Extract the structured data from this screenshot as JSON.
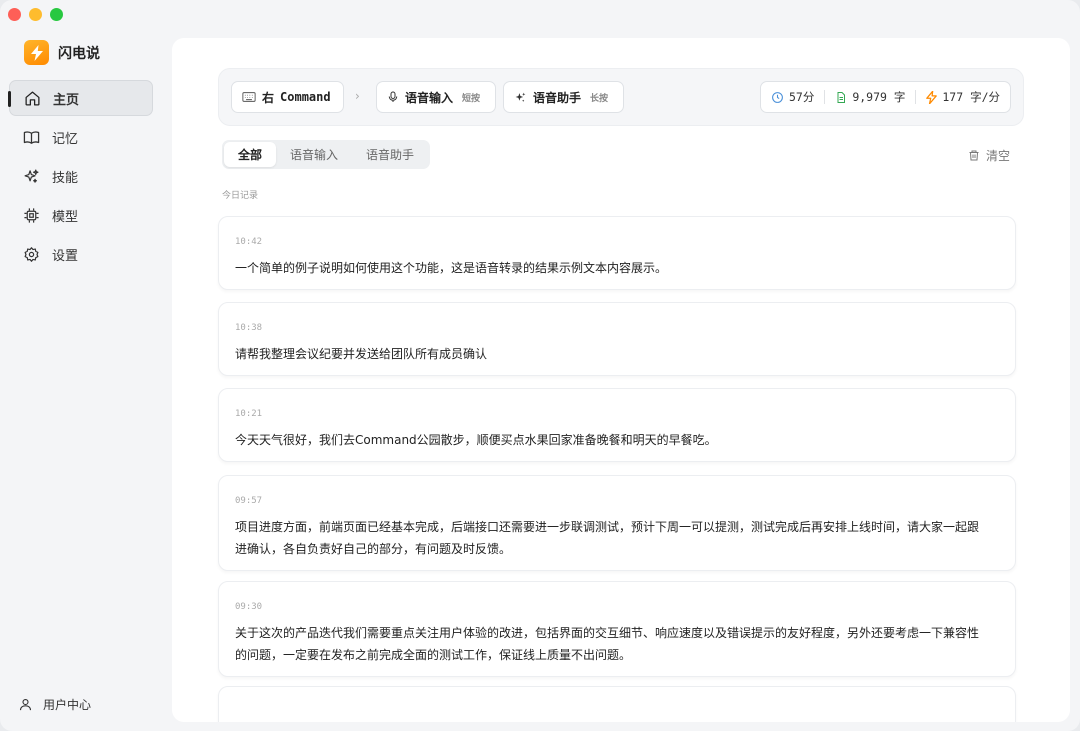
{
  "app": {
    "name": "闪电说"
  },
  "sidebar": {
    "items": [
      {
        "label": "主页",
        "icon": "home-icon",
        "active": true
      },
      {
        "label": "记忆",
        "icon": "book-icon",
        "active": false
      },
      {
        "label": "技能",
        "icon": "sparkles-icon",
        "active": false
      },
      {
        "label": "模型",
        "icon": "cpu-icon",
        "active": false
      },
      {
        "label": "设置",
        "icon": "gear-icon",
        "active": false
      }
    ],
    "user_center": "用户中心"
  },
  "topbar": {
    "shortcut_key": "右",
    "shortcut_name": "Command",
    "voice_input": {
      "label": "语音输入",
      "hint": "短按"
    },
    "voice_assistant": {
      "label": "语音助手",
      "hint": "长按"
    },
    "stats": {
      "minutes": "57分",
      "chars": "9,979 字",
      "speed": "177 字/分"
    }
  },
  "tabs": [
    "全部",
    "语音输入",
    "语音助手"
  ],
  "clear_label": "清空",
  "section_label": "今日记录",
  "entries": [
    {
      "time": "10:42",
      "text": "一个简单的例子说明如何使用这个功能，这是语音转录的结果示例文本内容展示。"
    },
    {
      "time": "10:38",
      "text": "请帮我整理会议纪要并发送给团队所有成员确认"
    },
    {
      "time": "10:21",
      "text": "今天天气很好，我们去Command公园散步，顺便买点水果回家准备晚餐和明天的早餐吃。"
    },
    {
      "time": "09:57",
      "text": "项目进度方面，前端页面已经基本完成，后端接口还需要进一步联调测试，预计下周一可以提测，测试完成后再安排上线时间，请大家一起跟进确认，各自负责好自己的部分，有问题及时反馈。"
    },
    {
      "time": "09:30",
      "text": "关于这次的产品迭代我们需要重点关注用户体验的改进，包括界面的交互细节、响应速度以及错误提示的友好程度，另外还要考虑一下兼容性的问题，一定要在发布之前完成全面的测试工作，保证线上质量不出问题。"
    }
  ],
  "colors": {
    "accent": "#ff9a1a",
    "clock": "#4a90d9",
    "doc": "#34a853",
    "bolt": "#ff8a00"
  }
}
